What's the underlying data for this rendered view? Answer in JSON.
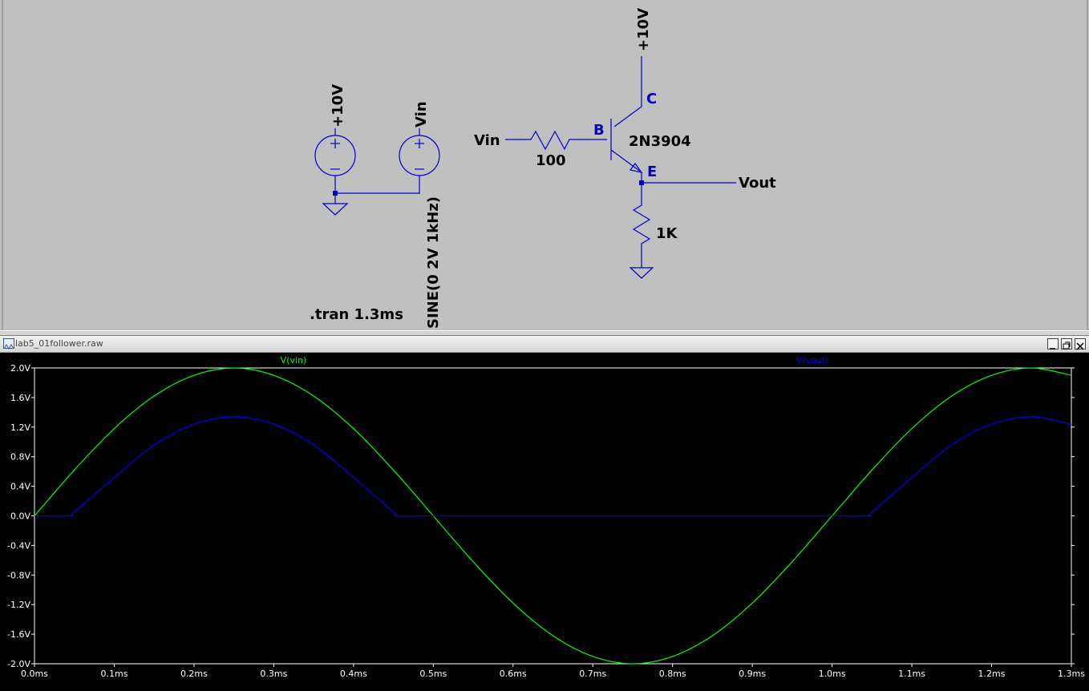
{
  "schematic": {
    "supply_label": "+10V",
    "vin_source_label": "Vin",
    "vin_source_value": "SINE(0 2V 1kHz)",
    "collector_rail_label": "+10V",
    "input_net_label": "Vin",
    "base_resistor_value": "100",
    "transistor_model": "2N3904",
    "pin_base": "B",
    "pin_collector": "C",
    "pin_emitter": "E",
    "output_net_label": "Vout",
    "emitter_resistor_value": "1K",
    "directive": ".tran 1.3ms",
    "wire_color": "#0000cc"
  },
  "plot_window": {
    "title": "lab5_01follower.raw",
    "buttons": [
      "minimize",
      "restore",
      "close"
    ]
  },
  "chart_data": {
    "type": "line",
    "x_unit": "ms",
    "y_unit": "V",
    "xlim": [
      0,
      1.3
    ],
    "ylim": [
      -2.0,
      2.0
    ],
    "x_ticks": [
      "0.0ms",
      "0.1ms",
      "0.2ms",
      "0.3ms",
      "0.4ms",
      "0.5ms",
      "0.6ms",
      "0.7ms",
      "0.8ms",
      "0.9ms",
      "1.0ms",
      "1.1ms",
      "1.2ms",
      "1.3ms"
    ],
    "y_ticks": [
      "2.0V",
      "1.6V",
      "1.2V",
      "0.8V",
      "0.4V",
      "0.0V",
      "-0.4V",
      "-0.8V",
      "-1.2V",
      "-1.6V",
      "-2.0V"
    ],
    "grid": false,
    "background": "#000000",
    "series": [
      {
        "name": "V(vin)",
        "color": "#00ff00",
        "x": [
          0,
          0.05,
          0.1,
          0.15,
          0.2,
          0.25,
          0.3,
          0.35,
          0.4,
          0.45,
          0.5,
          0.55,
          0.6,
          0.65,
          0.7,
          0.75,
          0.8,
          0.85,
          0.9,
          0.95,
          1.0,
          1.05,
          1.1,
          1.15,
          1.2,
          1.25,
          1.3
        ],
        "y": [
          0,
          0.62,
          1.18,
          1.62,
          1.9,
          2.0,
          1.9,
          1.62,
          1.18,
          0.62,
          0,
          -0.62,
          -1.18,
          -1.62,
          -1.9,
          -2.0,
          -1.9,
          -1.62,
          -1.18,
          -0.62,
          0,
          0.62,
          1.18,
          1.62,
          1.9,
          2.0,
          1.9
        ]
      },
      {
        "name": "V(vout)",
        "color": "#0000ff",
        "x": [
          0,
          0.045,
          0.05,
          0.1,
          0.15,
          0.2,
          0.25,
          0.3,
          0.35,
          0.4,
          0.45,
          0.455,
          0.5,
          0.6,
          0.7,
          0.8,
          0.9,
          1.0,
          1.045,
          1.05,
          1.1,
          1.15,
          1.2,
          1.25,
          1.3
        ],
        "y": [
          0,
          0,
          0.05,
          0.52,
          0.96,
          1.24,
          1.34,
          1.24,
          0.96,
          0.52,
          0.05,
          0,
          0,
          0,
          0,
          0,
          0,
          0,
          0,
          0.05,
          0.52,
          0.96,
          1.24,
          1.34,
          1.24
        ]
      }
    ]
  }
}
